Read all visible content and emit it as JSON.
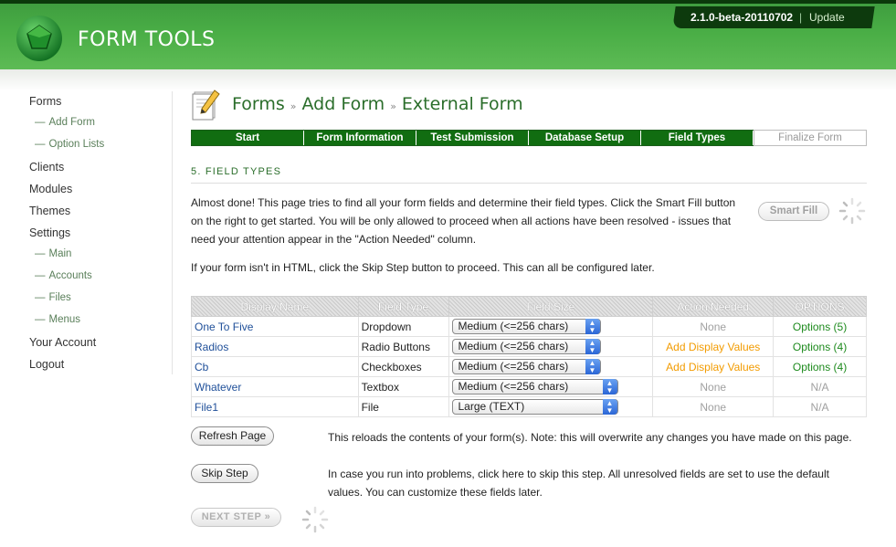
{
  "header": {
    "app_name": "FORM TOOLS",
    "version": "2.1.0-beta-20110702",
    "separator": "|",
    "update_label": "Update"
  },
  "sidebar": {
    "items": [
      {
        "label": "Forms",
        "type": "main"
      },
      {
        "label": "Add Form",
        "type": "sub"
      },
      {
        "label": "Option Lists",
        "type": "sub"
      },
      {
        "label": "Clients",
        "type": "main"
      },
      {
        "label": "Modules",
        "type": "main"
      },
      {
        "label": "Themes",
        "type": "main"
      },
      {
        "label": "Settings",
        "type": "main"
      },
      {
        "label": "Main",
        "type": "sub"
      },
      {
        "label": "Accounts",
        "type": "sub"
      },
      {
        "label": "Files",
        "type": "sub"
      },
      {
        "label": "Menus",
        "type": "sub"
      },
      {
        "label": "Your Account",
        "type": "main"
      },
      {
        "label": "Logout",
        "type": "main"
      }
    ],
    "sub_dash": "—"
  },
  "breadcrumb": {
    "items": [
      "Forms",
      "Add Form",
      "External Form"
    ],
    "separator": "»"
  },
  "steps": [
    "Start",
    "Form Information",
    "Test Submission",
    "Database Setup",
    "Field Types",
    "Finalize Form"
  ],
  "section_title": "5. FIELD TYPES",
  "intro_text": "Almost done! This page tries to find all your form fields and determine their field types. Click the Smart Fill button on the right to get started. You will be only allowed to proceed when all actions have been resolved - issues that need your attention appear in the \"Action Needed\" column.",
  "skip_note": "If your form isn't in HTML, click the Skip Step button to proceed. This can all be configured later.",
  "smart_fill_label": "Smart Fill",
  "table": {
    "headers": [
      "Display Name",
      "Field Type",
      "Field Size",
      "Action Needed",
      "OPTIONS"
    ],
    "rows": [
      {
        "name": "One To Five",
        "type": "Dropdown",
        "size": "Medium (<=256 chars)",
        "action": "None",
        "action_style": "muted",
        "options": "Options (5)",
        "options_style": "green"
      },
      {
        "name": "Radios",
        "type": "Radio Buttons",
        "size": "Medium (<=256 chars)",
        "action": "Add Display Values",
        "action_style": "orange",
        "options": "Options (4)",
        "options_style": "green"
      },
      {
        "name": "Cb",
        "type": "Checkboxes",
        "size": "Medium (<=256 chars)",
        "action": "Add Display Values",
        "action_style": "orange",
        "options": "Options (4)",
        "options_style": "green"
      },
      {
        "name": "Whatever",
        "type": "Textbox",
        "size": "Medium (<=256 chars)",
        "action": "None",
        "action_style": "muted",
        "options": "N/A",
        "options_style": "muted"
      },
      {
        "name": "File1",
        "type": "File",
        "size": "Large (TEXT)",
        "action": "None",
        "action_style": "muted",
        "options": "N/A",
        "options_style": "muted"
      }
    ]
  },
  "refresh": {
    "label": "Refresh Page",
    "desc": "This reloads the contents of your form(s). Note: this will overwrite any changes you have made on this page."
  },
  "skip": {
    "label": "Skip Step",
    "desc": "In case you run into problems, click here to skip this step. All unresolved fields are set to use the default values. You can customize these fields later."
  },
  "next_label": "NEXT STEP »",
  "colors": {
    "brand_green": "#2b6e2b",
    "step_green": "#116d11",
    "link_blue": "#1f4f99",
    "warning_orange": "#f29b00"
  }
}
